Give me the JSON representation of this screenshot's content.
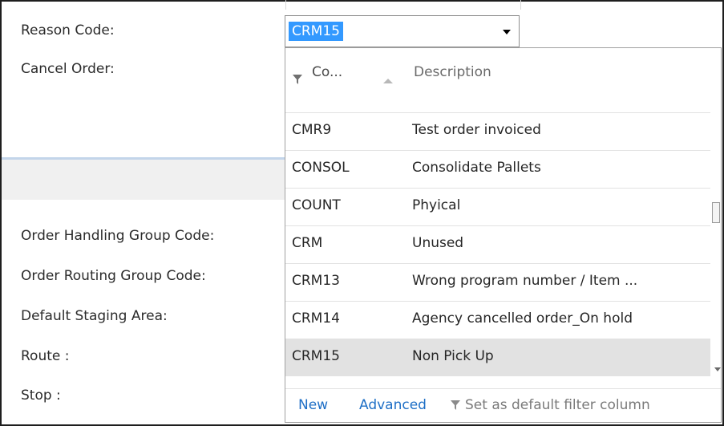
{
  "form": {
    "reason_code_label": "Reason Code:",
    "cancel_order_label": "Cancel Order:",
    "handling_group_label": "Order Handling Group Code:",
    "routing_group_label": "Order Routing Group Code:",
    "staging_area_label": "Default Staging Area:",
    "route_label": "Route :",
    "stop_label": "Stop :"
  },
  "combo": {
    "value": "CRM15",
    "icon": "chevron-down-icon"
  },
  "dropdown": {
    "columns": {
      "code": "Co...",
      "description": "Description"
    },
    "rows": [
      {
        "code": "CMR9",
        "description": "Test order invoiced"
      },
      {
        "code": "CONSOL",
        "description": "Consolidate Pallets"
      },
      {
        "code": "COUNT",
        "description": "Phyical"
      },
      {
        "code": "CRM",
        "description": "Unused"
      },
      {
        "code": "CRM13",
        "description": "Wrong program number / Item ..."
      },
      {
        "code": "CRM14",
        "description": "Agency cancelled order_On hold"
      },
      {
        "code": "CRM15",
        "description": "Non Pick Up"
      }
    ],
    "footer": {
      "new_label": "New",
      "advanced_label": "Advanced",
      "default_filter_label": "Set as default filter column"
    }
  },
  "colors": {
    "selection": "#3399ff",
    "link": "#1e6fc6",
    "selected_row": "#e2e2e2"
  }
}
